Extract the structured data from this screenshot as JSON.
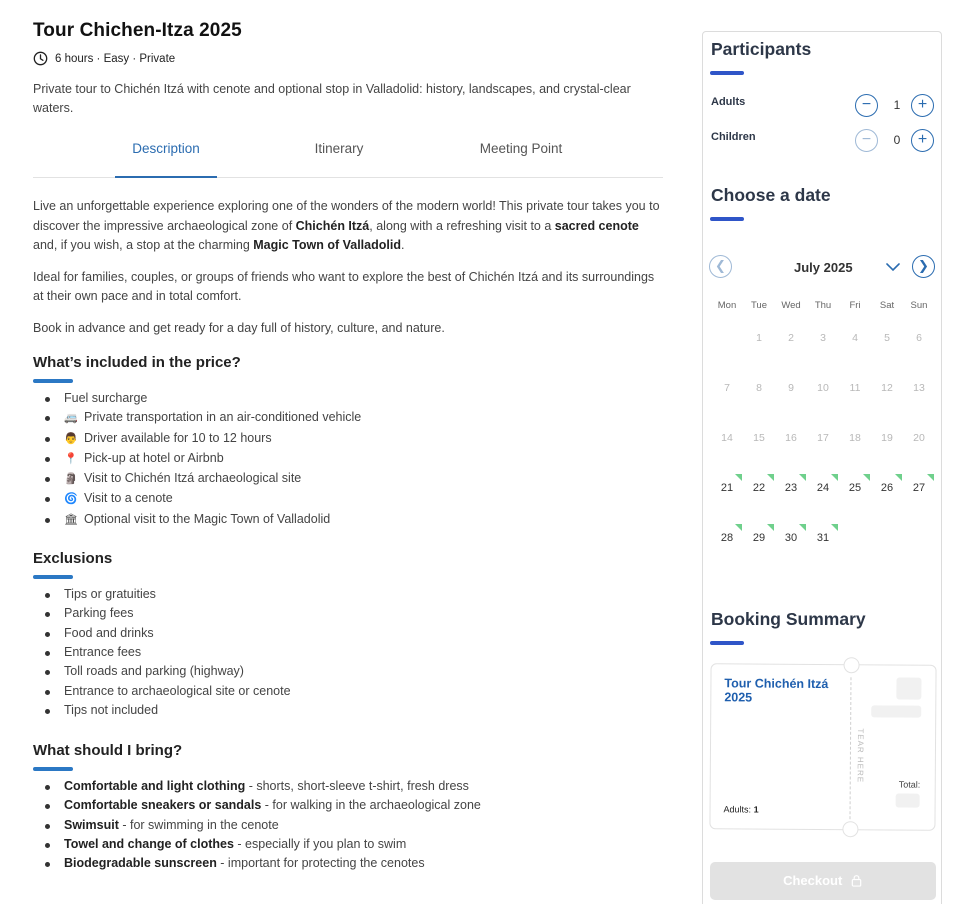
{
  "tour": {
    "title": "Tour Chichen-Itza 2025",
    "meta": "6 hours · Easy · Private",
    "summary": "Private tour to Chichén Itzá with cenote and optional stop in Valladolid: history, landscapes, and crystal-clear waters."
  },
  "tabs": [
    {
      "label": "Description",
      "active": true
    },
    {
      "label": "Itinerary",
      "active": false
    },
    {
      "label": "Meeting Point",
      "active": false
    }
  ],
  "description": {
    "p1_a": "Live an unforgettable experience exploring one of the wonders of the modern world! This private tour takes you to discover the impressive archaeological zone of ",
    "p1_b": "Chichén Itzá",
    "p1_c": ", along with a refreshing visit to a ",
    "p1_d": "sacred cenote",
    "p1_e": " and, if you wish, a stop at the charming ",
    "p1_f": "Magic Town of Valladolid",
    "p1_g": ".",
    "p2": "Ideal for families, couples, or groups of friends who want to explore the best of Chichén Itzá and its surroundings at their own pace and in total comfort.",
    "p3": "Book in advance and get ready for a day full of history, culture, and nature."
  },
  "included": {
    "heading": "What’s included in the price?",
    "items": [
      {
        "icon": "",
        "icon_name": "",
        "text": "Fuel surcharge"
      },
      {
        "icon": "🚐",
        "icon_name": "van-icon",
        "text": "Private transportation in an air-conditioned vehicle"
      },
      {
        "icon": "👨",
        "icon_name": "driver-icon",
        "text": "Driver available for 10 to 12 hours"
      },
      {
        "icon": "📍",
        "icon_name": "pin-icon",
        "text": "Pick-up at hotel or Airbnb"
      },
      {
        "icon": "🗿",
        "icon_name": "monument-icon",
        "text": "Visit to Chichén Itzá archaeological site"
      },
      {
        "icon": "🌀",
        "icon_name": "cenote-icon",
        "text": "Visit to a cenote"
      },
      {
        "icon": "🏛",
        "icon_name": "town-icon",
        "text": "Optional visit to the Magic Town of Valladolid"
      }
    ]
  },
  "exclusions": {
    "heading": "Exclusions",
    "items": [
      "Tips or gratuities",
      "Parking fees",
      "Food and drinks",
      "Entrance fees",
      "Toll roads and parking (highway)",
      "Entrance to archaeological site or cenote",
      "Tips not included"
    ]
  },
  "bring": {
    "heading": "What should I bring?",
    "items": [
      {
        "bold": "Comfortable and light clothing",
        "rest": " - shorts, short-sleeve t-shirt, fresh dress"
      },
      {
        "bold": "Comfortable sneakers or sandals",
        "rest": " - for walking in the archaeological zone"
      },
      {
        "bold": "Swimsuit",
        "rest": " - for swimming in the cenote"
      },
      {
        "bold": "Towel and change of clothes",
        "rest": " - especially if you plan to swim"
      },
      {
        "bold": "Biodegradable sunscreen",
        "rest": " - important for protecting the cenotes"
      }
    ]
  },
  "participants": {
    "heading": "Participants",
    "adults_label": "Adults",
    "adults_count": "1",
    "children_label": "Children",
    "children_count": "0",
    "minus": "−",
    "plus": "+"
  },
  "calendar": {
    "heading": "Choose a date",
    "month": "July 2025",
    "weekdays": [
      "Mon",
      "Tue",
      "Wed",
      "Thu",
      "Fri",
      "Sat",
      "Sun"
    ],
    "first_weekday_index": 1,
    "days_in_month": 31,
    "first_available_day": 21
  },
  "booking": {
    "heading": "Booking Summary",
    "ticket_title": "Tour Chichén Itzá 2025",
    "tear_text": "TEAR HERE",
    "adults_label": "Adults:",
    "adults_value": "1",
    "total_label": "Total:",
    "checkout_label": "Checkout"
  },
  "colors": {
    "accent": "#2b6cb0",
    "heading_underline": "#2b78c4",
    "panel_bar": "#2f55c8",
    "available_marker": "#6fd08c",
    "disabled_button": "#e2e2e2"
  }
}
